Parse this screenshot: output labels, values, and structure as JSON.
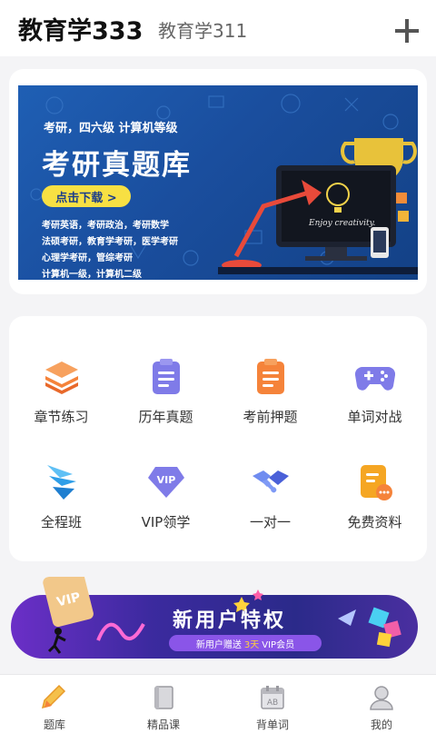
{
  "header": {
    "tab_active": "教育学333",
    "tab_other": "教育学311",
    "add_icon": "plus-icon"
  },
  "banner": {
    "tagline": "考研，四六级  计算机等级",
    "title": "考研真题库",
    "button": "点击下载 >",
    "desc_lines": [
      "考研英语，考研政治，考研数学",
      "法硕考研，教育学考研，医学考研",
      "心理学考研，管综考研",
      "计算机一级，计算机二级"
    ],
    "screen_text": "Enjoy creativity."
  },
  "features": [
    {
      "label": "章节练习",
      "icon": "layers-icon",
      "color": "#f5833a"
    },
    {
      "label": "历年真题",
      "icon": "clipboard-list-icon",
      "color": "#7f7be8"
    },
    {
      "label": "考前押题",
      "icon": "clipboard-check-icon",
      "color": "#f5833a"
    },
    {
      "label": "单词对战",
      "icon": "gamepad-icon",
      "color": "#7f7be8"
    },
    {
      "label": "全程班",
      "icon": "wing-icon",
      "color": "#2f9ee8"
    },
    {
      "label": "VIP领学",
      "icon": "vip-gem-icon",
      "color": "#7f7be8"
    },
    {
      "label": "一对一",
      "icon": "handshake-icon",
      "color": "#5a74e8"
    },
    {
      "label": "免费资料",
      "icon": "document-more-icon",
      "color": "#f5a623"
    }
  ],
  "promo": {
    "title": "新用户特权",
    "pill_prefix": "新用户赠送",
    "pill_highlight": "3天",
    "pill_suffix": "VIP会员",
    "card_text": "VIP"
  },
  "bottom_nav": [
    {
      "label": "题库",
      "icon": "pencil-icon",
      "active": true
    },
    {
      "label": "精品课",
      "icon": "book-icon",
      "active": false
    },
    {
      "label": "背单词",
      "icon": "calendar-ab-icon",
      "active": false
    },
    {
      "label": "我的",
      "icon": "user-icon",
      "active": false
    }
  ]
}
